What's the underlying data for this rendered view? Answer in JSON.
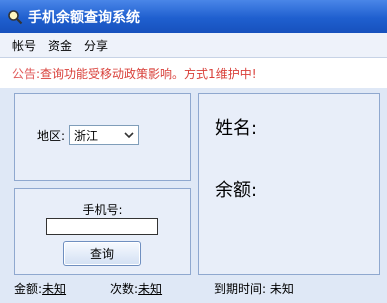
{
  "window": {
    "title": "手机余额查询系统"
  },
  "menu": {
    "items": [
      "帐号",
      "资金",
      "分享"
    ]
  },
  "notice": {
    "label": "公告",
    "text": ":查询功能受移动政策影响。方式1维护中!"
  },
  "region": {
    "label": "地区:",
    "selected": "浙江"
  },
  "phone": {
    "label": "手机号:",
    "value": "",
    "query_button": "查询"
  },
  "result": {
    "name_label": "姓名:",
    "balance_label": "余额:"
  },
  "status": {
    "amount_label": "金额:",
    "amount_value": "未知",
    "count_label": "次数:",
    "count_value": "未知",
    "expire_label": "到期时间:",
    "expire_value": "未知"
  }
}
